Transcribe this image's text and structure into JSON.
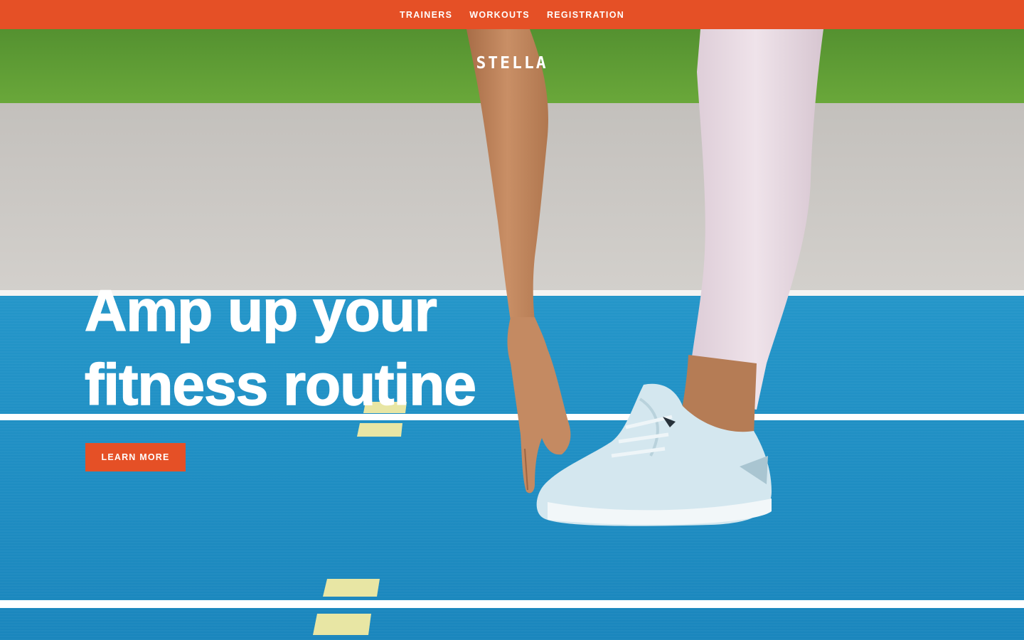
{
  "nav": {
    "items": [
      {
        "label": "TRAINERS"
      },
      {
        "label": "WORKOUTS"
      },
      {
        "label": "REGISTRATION"
      }
    ],
    "background": "#e55026"
  },
  "brand": {
    "logo_text": "STELLA"
  },
  "hero": {
    "headline_line1": "Amp up your",
    "headline_line2": "fitness routine",
    "cta_label": "LEARN MORE",
    "image": "hero-photo-runner-stretching-on-track",
    "colors": {
      "grass": "#5b9a32",
      "concrete": "#c9c6c2",
      "track": "#1e8fc4",
      "lane_line": "#ffffff",
      "lane_marker": "#e9e7a6",
      "leggings": "#ebdde6",
      "skin": "#c48a62",
      "shoe": "#d3e6ee"
    }
  }
}
